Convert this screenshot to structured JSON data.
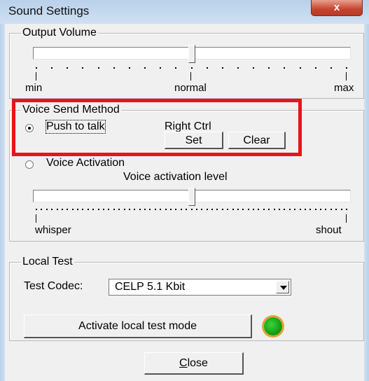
{
  "window": {
    "title": "Sound Settings",
    "close_glyph": "x"
  },
  "output_volume": {
    "group_label": "Output Volume",
    "slider_level": 0.5,
    "min_label": "min",
    "normal_label": "normal",
    "max_label": "max"
  },
  "voice_send": {
    "group_label": "Voice Send Method",
    "push_to_talk_label": "Push to talk",
    "hotkey_value": "Right Ctrl",
    "set_label": "Set",
    "clear_label": "Clear",
    "voice_activation_label": "Voice Activation",
    "activation_level_label": "Voice activation level",
    "activation_slider_level": 0.5,
    "whisper_label": "whisper",
    "shout_label": "shout",
    "selected": "Push to talk"
  },
  "local_test": {
    "group_label": "Local Test",
    "codec_label": "Test Codec:",
    "codec_value": "CELP 5.1 Kbit",
    "activate_label": "Activate local test mode",
    "indicator_color": "#1aa81a"
  },
  "footer": {
    "close_label": "Close"
  },
  "colors": {
    "highlight_box": "#e8141a",
    "title_bar": "#b9d1ea"
  }
}
